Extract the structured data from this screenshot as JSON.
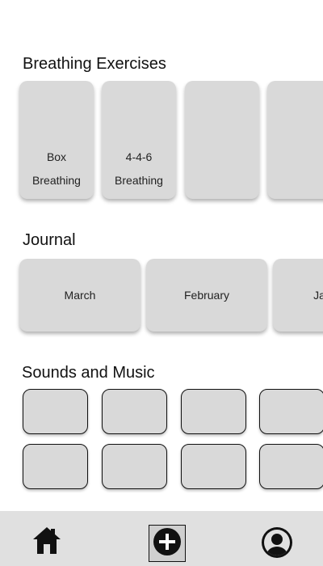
{
  "breathing": {
    "title": "Breathing Exercises",
    "cards": [
      {
        "line1": "Box",
        "line2": "Breathing"
      },
      {
        "line1": "4-4-6",
        "line2": "Breathing"
      },
      {
        "line1": "",
        "line2": ""
      },
      {
        "line1": "",
        "line2": ""
      }
    ]
  },
  "journal": {
    "title": "Journal",
    "entries": [
      "March",
      "February",
      "January"
    ]
  },
  "sounds": {
    "title": "Sounds and Music"
  },
  "nav": {
    "home_icon": "home-icon",
    "add_icon": "plus-circle-icon",
    "profile_icon": "user-avatar-icon"
  },
  "colors": {
    "background": "#ffffff",
    "card": "#d9d9d9",
    "nav_bar": "#e0e0e0",
    "icon": "#111111"
  }
}
